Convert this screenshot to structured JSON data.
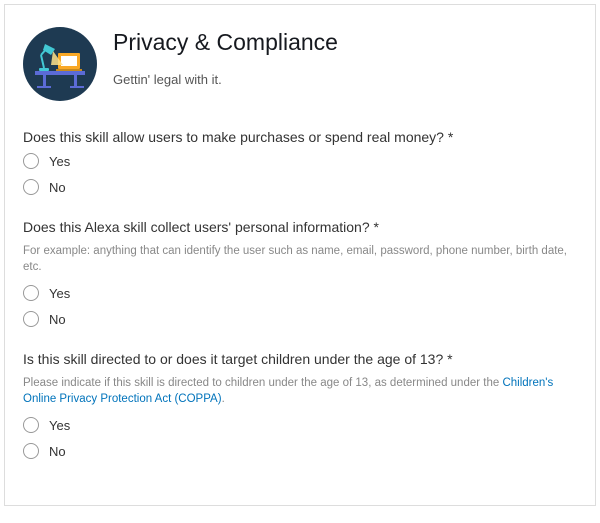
{
  "header": {
    "title": "Privacy & Compliance",
    "subtitle": "Gettin' legal with it."
  },
  "q1": {
    "question": "Does this skill allow users to make purchases or spend real money? *",
    "yes": "Yes",
    "no": "No"
  },
  "q2": {
    "question": "Does this Alexa skill collect users' personal information? *",
    "hint": "For example: anything that can identify the user such as name, email, password, phone number, birth date, etc.",
    "yes": "Yes",
    "no": "No"
  },
  "q3": {
    "question": "Is this skill directed to or does it target children under the age of 13? *",
    "hint_prefix": "Please indicate if this skill is directed to children under the age of 13, as determined under the ",
    "link_text": "Children's Online Privacy Protection Act (COPPA)",
    "hint_suffix": ".",
    "yes": "Yes",
    "no": "No"
  }
}
